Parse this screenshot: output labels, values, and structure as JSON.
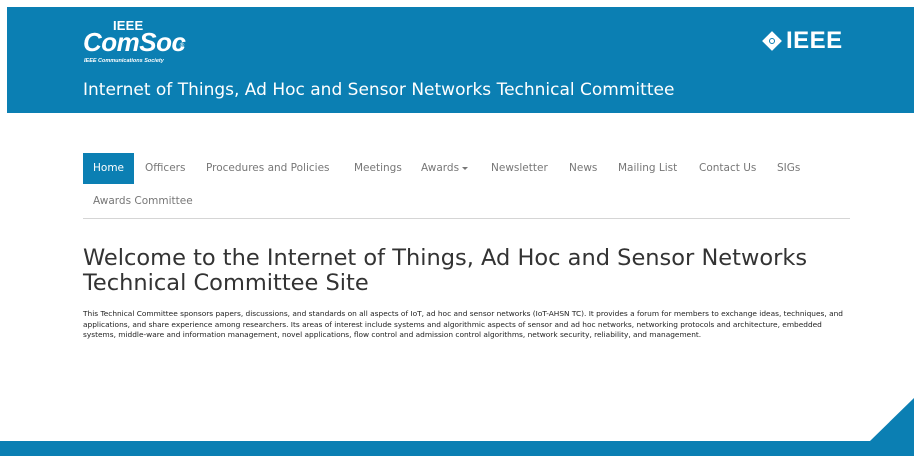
{
  "header": {
    "logo_top": "IEEE",
    "logo_main": "ComSoc",
    "logo_tm": "®",
    "logo_sub": "IEEE Communications Society",
    "ieee_logo": "IEEE",
    "site_title": "Internet of Things, Ad Hoc and Sensor Networks Technical Committee",
    "brand_color": "#0b7fb3"
  },
  "nav": {
    "items": [
      {
        "label": "Home",
        "active": true
      },
      {
        "label": "Officers"
      },
      {
        "label": "Procedures and Policies"
      },
      {
        "label": "Meetings"
      },
      {
        "label": "Awards",
        "dropdown": true
      },
      {
        "label": "Newsletter"
      },
      {
        "label": "News"
      },
      {
        "label": "Mailing List"
      },
      {
        "label": "Contact Us"
      },
      {
        "label": "SIGs"
      },
      {
        "label": "Awards Committee"
      }
    ]
  },
  "main": {
    "heading": "Welcome to the Internet of Things, Ad Hoc and Sensor Networks Technical Committee Site",
    "intro": "This Technical Committee sponsors papers, discussions, and standards on all aspects of IoT, ad hoc and sensor networks (IoT-AHSN TC). It provides a forum for members to exchange ideas, techniques, and applications, and share experience among researchers. Its areas of interest include systems and algorithmic aspects of sensor and ad hoc networks, networking protocols and architecture, embedded systems, middle-ware and information management, novel applications, flow control and admission control algorithms, network security, reliability, and management."
  }
}
